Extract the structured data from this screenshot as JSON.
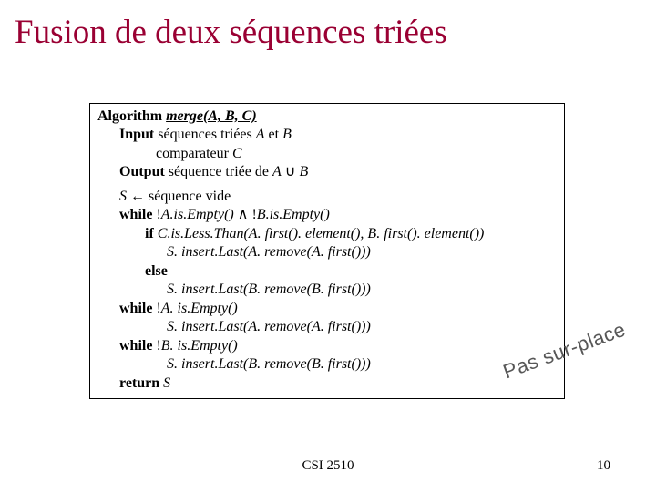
{
  "title": "Fusion de deux séquences triées",
  "algo": {
    "head_label": "Algorithm",
    "head_sig": "merge(A, B, C)",
    "input_label": "Input",
    "input_text": " séquences triées ",
    "input_A": "A",
    "input_et": " et ",
    "input_B": "B",
    "comp_text": "comparateur ",
    "comp_C": "C",
    "output_label": "Output",
    "output_text": " séquence triée de ",
    "output_A": "A",
    "union": " ∪ ",
    "output_B": "B",
    "s_var": "S",
    "arrow": " ← séquence vide",
    "w1_a": "while",
    "w1_b": " !",
    "w1_c": "A.is.Empty()",
    "w1_and": " ∧ ",
    "w1_d": "!",
    "w1_e": "B.is.Empty()",
    "if_a": "if",
    "if_b": " C.is.Less.Than(A. first(). element(), B. first(). element())",
    "l_ins1": "S. insert.Last(A. remove(A. first()))",
    "else": "else",
    "l_ins2": "S. insert.Last(B. remove(B. first()))",
    "w2_a": "while",
    "w2_b": " !",
    "w2_c": "A. is.Empty()",
    "l_ins3": "S. insert.Last(A. remove(A. first()))",
    "w3_a": "while",
    "w3_b": " !",
    "w3_c": "B. is.Empty()",
    "l_ins4": "S. insert.Last(B. remove(B. first()))",
    "ret_a": "return",
    "ret_b": " S"
  },
  "watermark": "Pas sur-place",
  "footer_center": "CSI 2510",
  "footer_right": "10"
}
